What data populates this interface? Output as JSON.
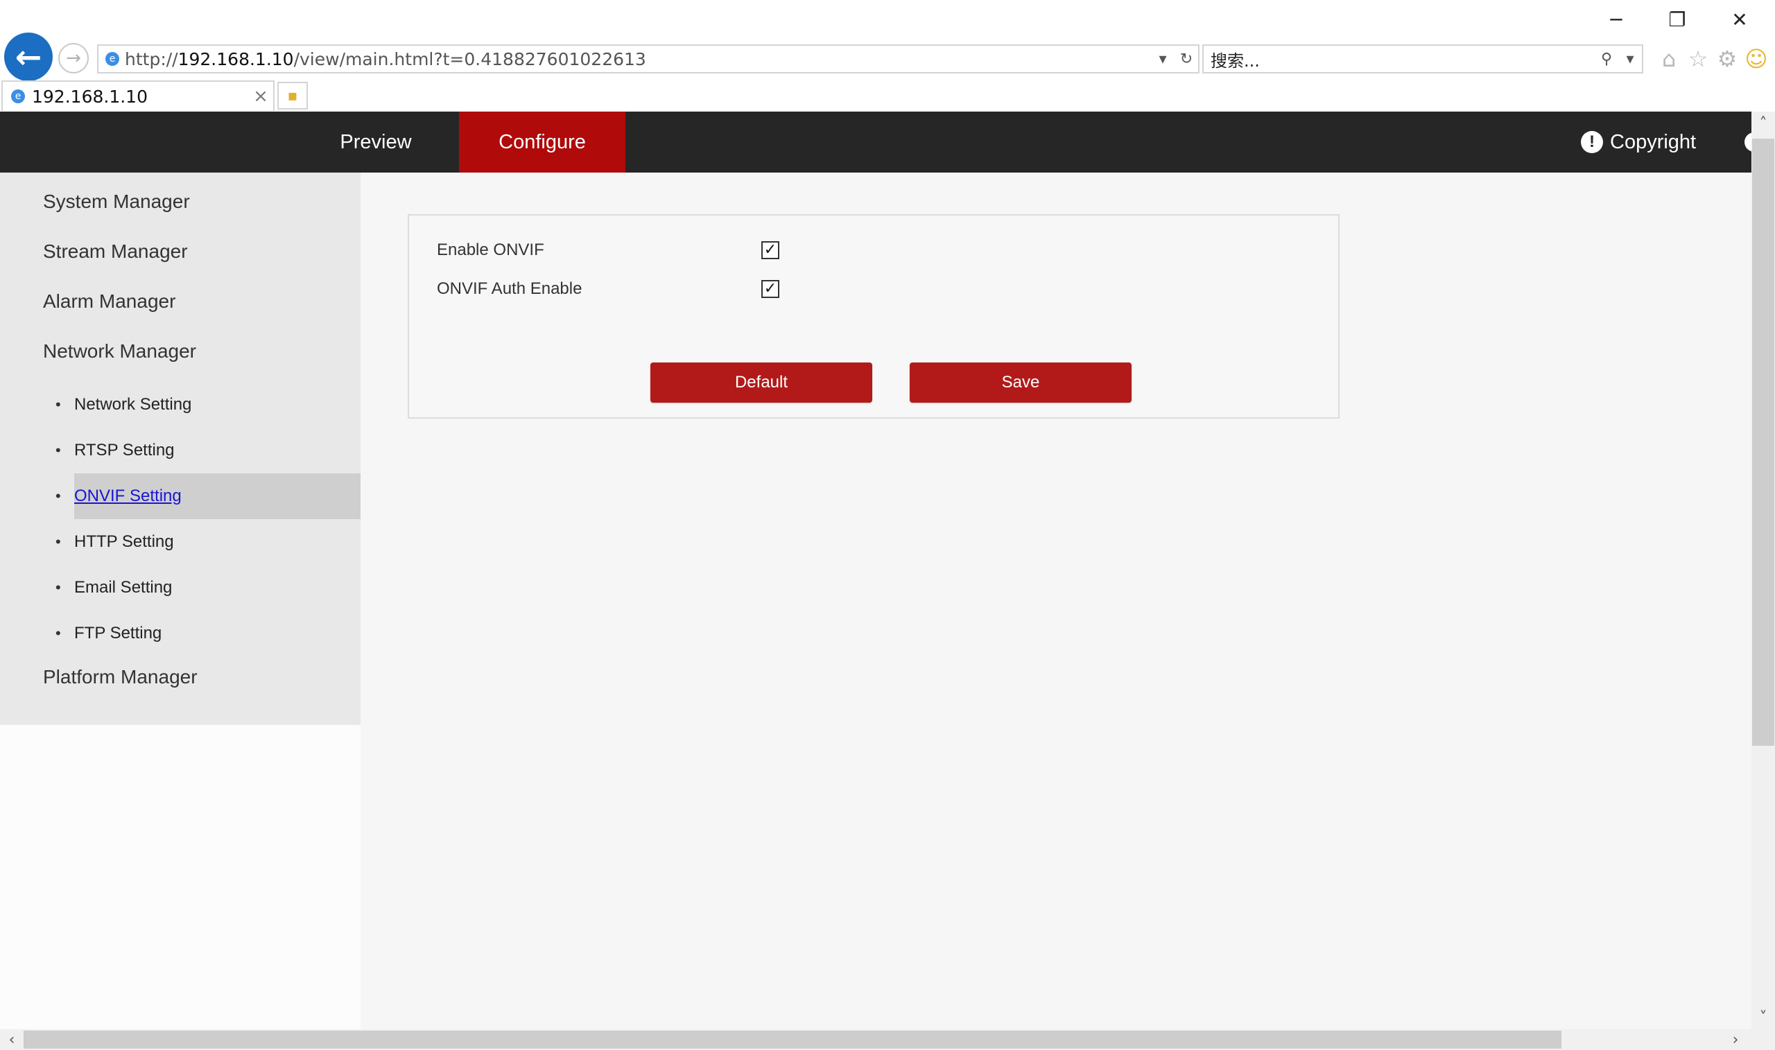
{
  "browser": {
    "url_prefix": "http://",
    "url_host": "192.168.1.10",
    "url_path": "/view/main.html?t=0.418827601022613",
    "search_placeholder": "搜索...",
    "tab_title": "192.168.1.10",
    "icons": [
      "back-arrow-icon",
      "forward-arrow-icon",
      "dropdown-icon",
      "refresh-icon",
      "search-icon",
      "home-icon",
      "star-icon",
      "gear-icon",
      "smiley-icon",
      "minimize-icon",
      "restore-icon",
      "close-icon"
    ]
  },
  "topnav": {
    "preview": "Preview",
    "configure": "Configure",
    "copyright": "Copyright",
    "active_color": "#b00a0a",
    "bar_color": "#262626"
  },
  "sidebar": {
    "groups": {
      "system": "System Manager",
      "stream": "Stream Manager",
      "alarm": "Alarm Manager",
      "network": "Network Manager",
      "platform": "Platform Manager"
    },
    "network_items": [
      {
        "label": "Network Setting"
      },
      {
        "label": "RTSP Setting"
      },
      {
        "label": "ONVIF Setting",
        "active": true
      },
      {
        "label": "HTTP Setting"
      },
      {
        "label": "Email Setting"
      },
      {
        "label": "FTP Setting"
      }
    ],
    "bullet": "•"
  },
  "onvif": {
    "enable_label": "Enable ONVIF",
    "enable_checked": true,
    "auth_label": "ONVIF Auth Enable",
    "auth_checked": true,
    "check_mark": "✓",
    "default_button": "Default",
    "save_button": "Save",
    "button_color": "#b21a1a"
  }
}
